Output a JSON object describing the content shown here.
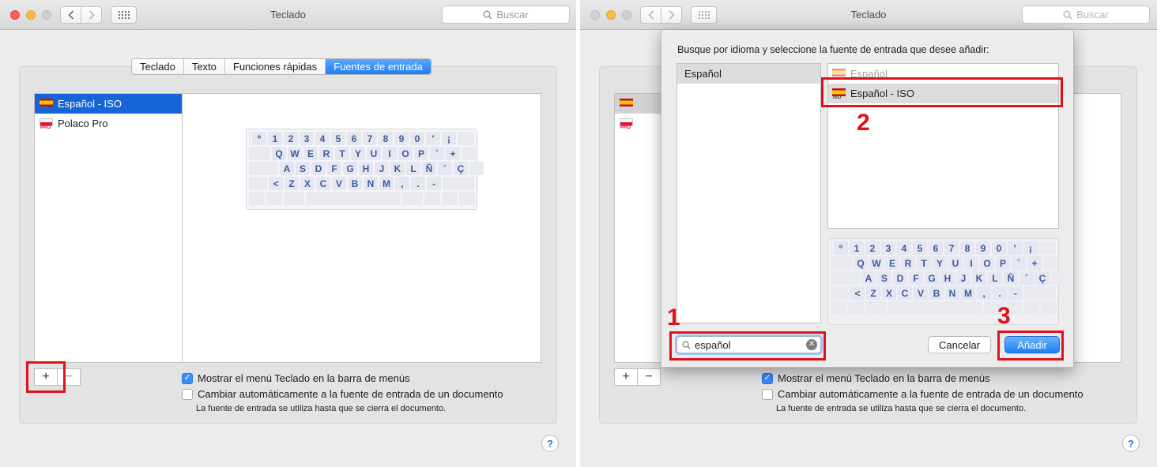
{
  "window": {
    "title": "Teclado",
    "search_placeholder": "Buscar"
  },
  "tabs": [
    {
      "label": "Teclado"
    },
    {
      "label": "Texto"
    },
    {
      "label": "Funciones rápidas"
    },
    {
      "label": "Fuentes de entrada",
      "active": true
    }
  ],
  "sources": [
    {
      "label": "Español - ISO",
      "flag": "es",
      "selected": true
    },
    {
      "label": "Polaco Pro",
      "flag": "pl",
      "tag": "PRO"
    }
  ],
  "keyboard": {
    "rows": [
      [
        "º",
        "1",
        "2",
        "3",
        "4",
        "5",
        "6",
        "7",
        "8",
        "9",
        "0",
        "'",
        "¡"
      ],
      [
        "Q",
        "W",
        "E",
        "R",
        "T",
        "Y",
        "U",
        "I",
        "O",
        "P",
        "`",
        "+"
      ],
      [
        "A",
        "S",
        "D",
        "F",
        "G",
        "H",
        "J",
        "K",
        "L",
        "Ñ",
        "´",
        "Ç"
      ],
      [
        "<",
        "Z",
        "X",
        "C",
        "V",
        "B",
        "N",
        "M",
        ",",
        ".",
        "-"
      ]
    ]
  },
  "controls": {
    "add_symbol": "+",
    "remove_symbol": "−",
    "show_menu_label": "Mostrar el menú Teclado en la barra de menús",
    "auto_switch_label": "Cambiar automáticamente a la fuente de entrada de un documento",
    "note": "La fuente de entrada se utiliza hasta que se cierra el documento.",
    "help_symbol": "?"
  },
  "sheet": {
    "prompt": "Busque por idioma y seleccione la fuente de entrada que desee añadir:",
    "languages": [
      "Español"
    ],
    "sources": [
      {
        "label": "Español",
        "dimmed": true
      },
      {
        "label": "Español - ISO",
        "tag": "ISO",
        "highlighted": true
      }
    ],
    "search_value": "español",
    "cancel_label": "Cancelar",
    "add_label": "Añadir"
  },
  "steps": [
    "1",
    "2",
    "3"
  ],
  "colors": {
    "accent": "#1f7ef6",
    "selection": "#1665d8",
    "annotation": "#e0101c"
  }
}
